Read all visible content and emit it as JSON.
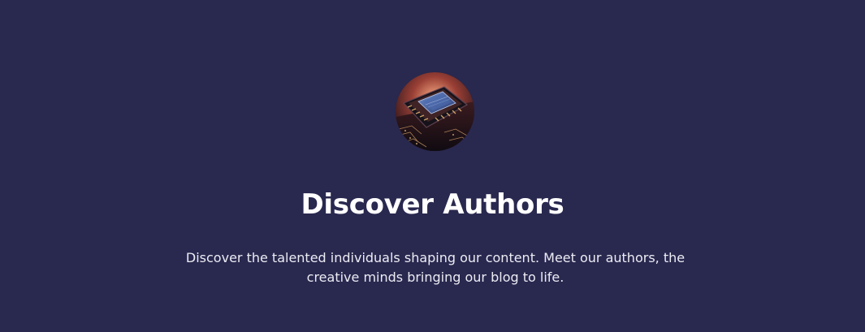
{
  "hero": {
    "image": {
      "alt": "Computer chip on circuit board",
      "icon": "cpu-chip-image"
    },
    "title": "Discover Authors",
    "description": "Discover the talented individuals shaping our content. Meet our authors, the creative minds bringing our blog to life."
  },
  "colors": {
    "background": "#29284f",
    "title": "#ffffff",
    "text": "#ececf4"
  }
}
